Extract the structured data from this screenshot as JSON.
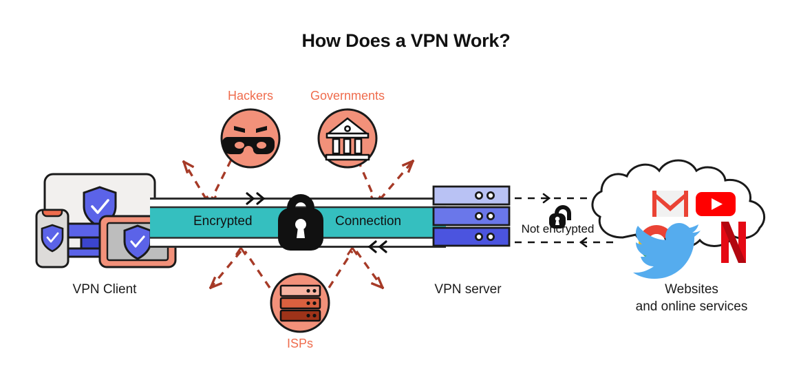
{
  "title": "How Does a VPN Work?",
  "colors": {
    "coral": "#f2917a",
    "coral_text": "#ef6c4d",
    "teal": "#35bfbf",
    "shield_blue": "#5b63e8",
    "dashed_red": "#a63a27",
    "outline": "#1a1a1a",
    "server_light": "#b9c2f4",
    "server_mid": "#6a77ea",
    "server_dark": "#4b54df",
    "gmail_red": "#ea4335",
    "youtube_red": "#ff0000",
    "twitter_blue": "#55acee",
    "netflix_red": "#e50914",
    "google_blue": "#4285f4",
    "google_green": "#34a853",
    "google_yellow": "#fbbc05",
    "google_red": "#ea4335"
  },
  "threats": [
    {
      "id": "hackers",
      "label": "Hackers",
      "icon": "masked-face-icon"
    },
    {
      "id": "governments",
      "label": "Governments",
      "icon": "bank-building-icon"
    },
    {
      "id": "isps",
      "label": "ISPs",
      "icon": "server-stack-icon"
    }
  ],
  "client": {
    "label": "VPN Client",
    "devices": [
      {
        "name": "monitor",
        "icon": "shield-check-icon"
      },
      {
        "name": "phone",
        "icon": "shield-check-icon"
      },
      {
        "name": "tablet",
        "icon": "shield-check-icon"
      }
    ]
  },
  "tunnel": {
    "text_left": "Encrypted",
    "text_right": "Connection",
    "lock_icon": "closed-padlock-icon",
    "arrow_forward": "››",
    "arrow_backward": "‹‹"
  },
  "server": {
    "label": "VPN server",
    "bays": 3,
    "leds_per_bay": 2
  },
  "unencrypted": {
    "label": "Not encrypted",
    "lock_icon": "open-padlock-icon"
  },
  "destination": {
    "label_line1": "Websites",
    "label_line2": "and online services",
    "logos": [
      {
        "id": "gmail",
        "name": "gmail-logo"
      },
      {
        "id": "youtube",
        "name": "youtube-logo"
      },
      {
        "id": "google",
        "name": "google-logo"
      },
      {
        "id": "twitter",
        "name": "twitter-logo"
      },
      {
        "id": "netflix",
        "name": "netflix-logo"
      }
    ]
  }
}
